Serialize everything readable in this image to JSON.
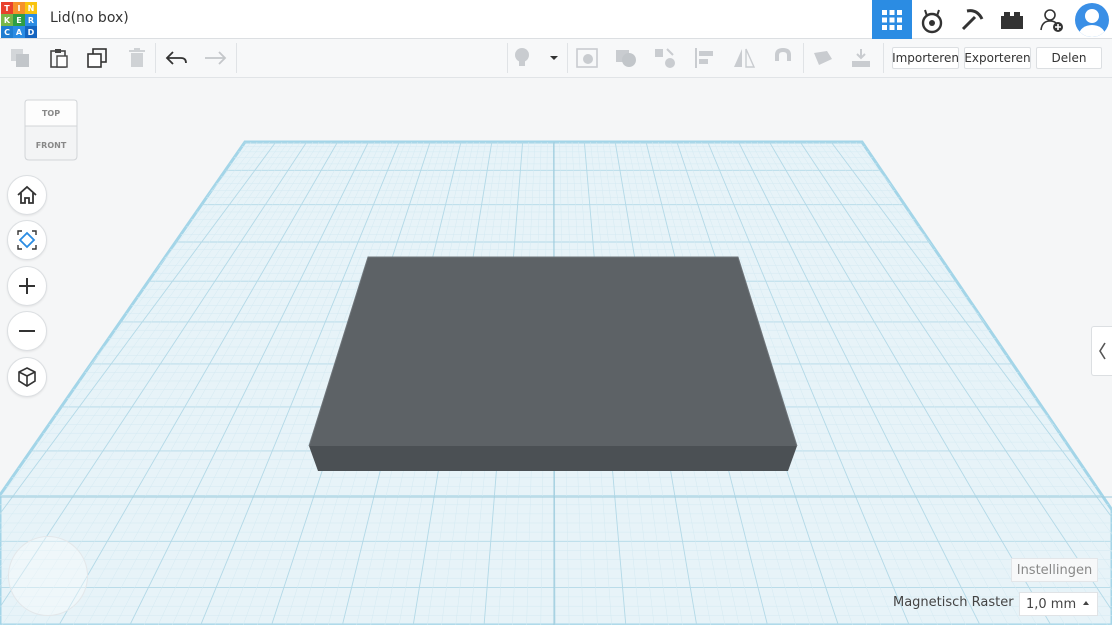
{
  "app": {
    "logo_letters": [
      "T",
      "I",
      "N",
      "K",
      "E",
      "R",
      "C",
      "A",
      "D"
    ],
    "logo_colors": [
      "#e8412c",
      "#f6922a",
      "#f9c40e",
      "#7ab648",
      "#2f9e44",
      "#2b8ce3",
      "#1f7dd1",
      "#2b8ce3",
      "#1565c0"
    ],
    "document_title": "Lid(no box)"
  },
  "header_icons": [
    {
      "name": "grid-view-icon",
      "active": true
    },
    {
      "name": "circuits-icon",
      "active": false
    },
    {
      "name": "minecraft-pickaxe-icon",
      "active": false
    },
    {
      "name": "lego-brick-icon",
      "active": false
    },
    {
      "name": "add-user-icon",
      "active": false
    },
    {
      "name": "avatar-icon",
      "active": false
    }
  ],
  "toolbar": {
    "left_icons": [
      "copy-icon",
      "paste-icon",
      "duplicate-icon",
      "delete-icon",
      "undo-icon",
      "redo-icon"
    ],
    "right_icons": [
      "light-bulb-icon",
      "dropdown-icon",
      "group-icon",
      "ungroup-icon",
      "workplane-icon",
      "align-icon",
      "mirror-icon",
      "magnet-icon",
      "note-icon",
      "drop-icon"
    ],
    "import_label": "Importeren",
    "export_label": "Exporteren",
    "share_label": "Delen"
  },
  "viewcube": {
    "top": "TOP",
    "front": "FRONT"
  },
  "nav_buttons": [
    "home-view-icon",
    "fit-view-icon",
    "zoom-in-icon",
    "zoom-out-icon",
    "perspective-icon"
  ],
  "bottom": {
    "settings_label": "Instellingen",
    "snap_label": "Magnetisch Raster",
    "snap_value": "1,0 mm"
  },
  "colors": {
    "accent": "#2b8ce3",
    "workplane": "#e6f3f8",
    "workplane_border": "#9fd3e6",
    "grid_line": "#b8dce9",
    "object_top": "#5d6266",
    "object_front": "#4b5054"
  }
}
